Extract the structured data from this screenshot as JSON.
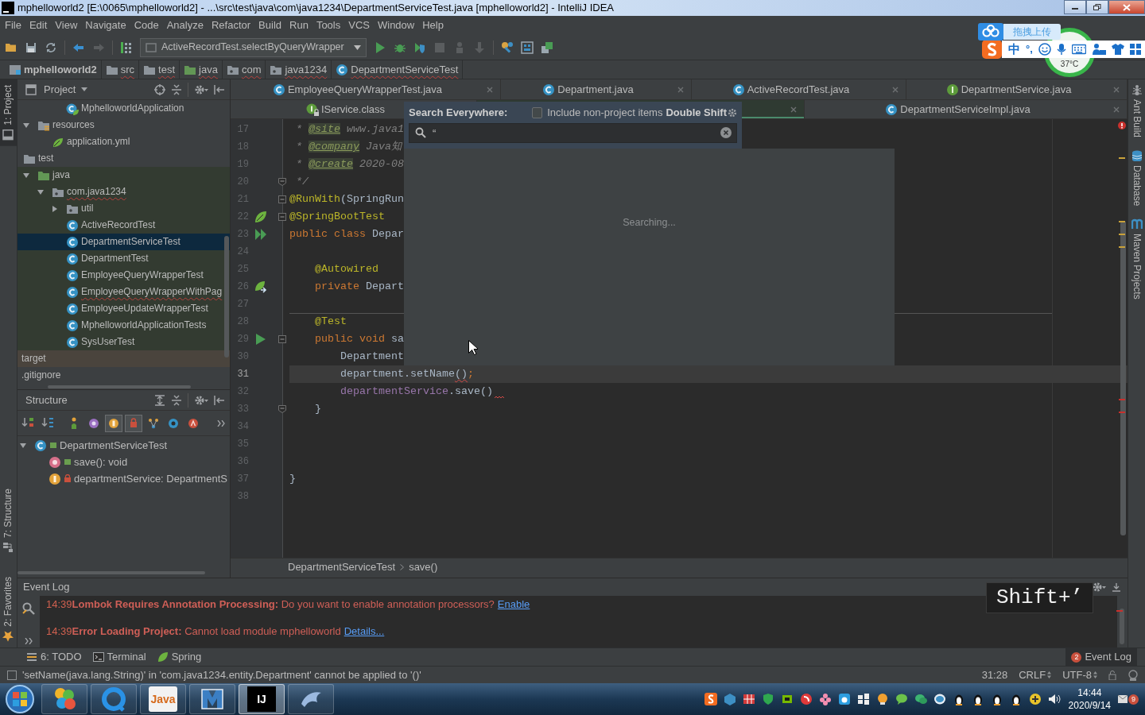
{
  "title_bar": {
    "title": "mphelloworld2 [E:\\0065\\mphelloworld2] - ...\\src\\test\\java\\com\\java1234\\DepartmentServiceTest.java [mphelloworld2] - IntelliJ IDEA"
  },
  "ime": {
    "upload_label": "拖拽上传",
    "mode": "中",
    "punctuation": "°,",
    "temperature": "37°C"
  },
  "menu": [
    "File",
    "Edit",
    "View",
    "Navigate",
    "Code",
    "Analyze",
    "Refactor",
    "Build",
    "Run",
    "Tools",
    "VCS",
    "Window",
    "Help"
  ],
  "toolbar": {
    "run_config": "ActiveRecordTest.selectByQueryWrapper"
  },
  "nav_bar": [
    {
      "label": "mphelloworld2",
      "kind": "module",
      "has_error": false
    },
    {
      "label": "src",
      "kind": "folder",
      "has_error": true
    },
    {
      "label": "test",
      "kind": "folder",
      "has_error": true
    },
    {
      "label": "java",
      "kind": "test-folder",
      "has_error": true
    },
    {
      "label": "com",
      "kind": "package",
      "has_error": true
    },
    {
      "label": "java1234",
      "kind": "package",
      "has_error": true
    },
    {
      "label": "DepartmentServiceTest",
      "kind": "class",
      "has_error": true
    }
  ],
  "left_strip": [
    {
      "label": "1: Project",
      "kind": "project",
      "selected": true
    },
    {
      "label": "7: Structure",
      "kind": "structure",
      "selected": false
    },
    {
      "label": "2: Favorites",
      "kind": "favorites",
      "selected": false
    }
  ],
  "right_strip": [
    {
      "label": "Ant Build",
      "kind": "ant",
      "selected": false
    },
    {
      "label": "Database",
      "kind": "database",
      "selected": false
    },
    {
      "label": "Maven Projects",
      "kind": "maven",
      "selected": false
    }
  ],
  "project_panel": {
    "title": "Project",
    "tree": [
      {
        "children": [
          {
            "children": [
              {
                "children": [
                  {
                    "children": [
                      {
                        "label": "MphelloworldApplication",
                        "kind": "spring-class",
                        "selected": false,
                        "has_error": false
                      }
                    ]
                  }
                ]
              },
              {
                "label": "resources",
                "kind": "resources-folder",
                "expanded": true,
                "selected": false,
                "has_error": false,
                "children": [
                  {
                    "label": "application.yml",
                    "kind": "yml",
                    "selected": false,
                    "has_error": false
                  }
                ]
              }
            ]
          },
          {
            "label": "test",
            "kind": "folder",
            "selected": false,
            "has_error": false,
            "children": [
              {
                "label": "java",
                "kind": "test-folder",
                "expanded": true,
                "selected": false,
                "has_error": false,
                "color": "#333b31",
                "children": [
                  {
                    "label": "com.java1234",
                    "kind": "package",
                    "expanded": true,
                    "selected": false,
                    "has_error": true,
                    "color": "#333b31",
                    "children": [
                      {
                        "label": "util",
                        "kind": "package",
                        "expanded": false,
                        "selected": false,
                        "has_error": false,
                        "color": "#333b31"
                      },
                      {
                        "label": "ActiveRecordTest",
                        "kind": "class",
                        "selected": false,
                        "has_error": false,
                        "color": "#333b31"
                      },
                      {
                        "label": "DepartmentServiceTest",
                        "kind": "class",
                        "selected": true,
                        "has_error": false
                      },
                      {
                        "label": "DepartmentTest",
                        "kind": "class",
                        "selected": false,
                        "has_error": false,
                        "color": "#333b31"
                      },
                      {
                        "label": "EmployeeQueryWrapperTest",
                        "kind": "class",
                        "selected": false,
                        "has_error": false,
                        "color": "#333b31"
                      },
                      {
                        "label": "EmployeeQueryWrapperWithPag",
                        "kind": "class",
                        "selected": false,
                        "has_error": true,
                        "color": "#333b31"
                      },
                      {
                        "label": "EmployeeUpdateWrapperTest",
                        "kind": "class",
                        "selected": false,
                        "has_error": false,
                        "color": "#333b31"
                      },
                      {
                        "label": "MphelloworldApplicationTests",
                        "kind": "class",
                        "selected": false,
                        "has_error": false,
                        "color": "#333b31"
                      },
                      {
                        "label": "SysUserTest",
                        "kind": "class",
                        "selected": false,
                        "has_error": false,
                        "color": "#333b31"
                      }
                    ]
                  }
                ]
              }
            ]
          }
        ]
      },
      {
        "label": "target",
        "selected": false,
        "has_error": false,
        "color": "#4a443d"
      },
      {
        "label": ".gitignore",
        "selected": false,
        "has_error": false
      }
    ]
  },
  "structure_panel": {
    "title": "Structure",
    "filters": [
      {
        "kind": "sort-visibility",
        "on": false
      },
      {
        "kind": "sort-alpha",
        "on": false
      },
      {
        "kind": "inherited",
        "on": false
      },
      {
        "kind": "properties",
        "on": false
      },
      {
        "kind": "fields",
        "on": true
      },
      {
        "kind": "non-public",
        "on": true
      },
      {
        "kind": "anonymous",
        "on": false
      },
      {
        "kind": "lambdas",
        "on": false
      },
      {
        "kind": "abstract",
        "on": false
      }
    ],
    "tree": [
      {
        "label": "DepartmentServiceTest",
        "kind": "class",
        "private": false,
        "expanded": true,
        "selected": false,
        "children": [
          {
            "label": "save(): void",
            "kind": "method",
            "private": false,
            "selected": false
          },
          {
            "label": "departmentService: DepartmentS",
            "kind": "field",
            "private": true,
            "selected": false
          }
        ]
      }
    ]
  },
  "editor": {
    "tab_rows": [
      [
        {
          "label": "EmployeeQueryWrapperTest.java",
          "kind": "class",
          "selected": false
        },
        {
          "label": "Department.java",
          "kind": "class",
          "selected": false
        },
        {
          "label": "ActiveRecordTest.java",
          "kind": "class",
          "selected": false
        },
        {
          "label": "DepartmentService.java",
          "kind": "interface",
          "selected": false
        }
      ],
      [
        {
          "label": "IService.class",
          "kind": "library-interface",
          "selected": false
        },
        {
          "selected": true
        },
        {
          "label": "DepartmentServiceImpl.java",
          "kind": "class",
          "selected": false
        }
      ]
    ],
    "lines": [
      {
        "number": "17",
        "segments": [
          {
            "text": " * ",
            "kind": "comment"
          },
          {
            "text": "@site",
            "kind": "doc-tag"
          },
          {
            "text": " www.java1",
            "kind": "comment"
          }
        ]
      },
      {
        "number": "18",
        "segments": [
          {
            "text": " * ",
            "kind": "comment"
          },
          {
            "text": "@company",
            "kind": "doc-tag"
          },
          {
            "text": " Java知",
            "kind": "comment"
          }
        ]
      },
      {
        "number": "19",
        "segments": [
          {
            "text": " * ",
            "kind": "comment"
          },
          {
            "text": "@create",
            "kind": "doc-tag"
          },
          {
            "text": " 2020-08",
            "kind": "comment"
          }
        ]
      },
      {
        "number": "20",
        "fold": {
          "kind": "end"
        },
        "segments": [
          {
            "text": " */",
            "kind": "comment"
          }
        ]
      },
      {
        "number": "21",
        "fold": {
          "kind": "start"
        },
        "segments": [
          {
            "text": "@RunWith",
            "kind": "annotation"
          },
          {
            "text": "(SpringRun",
            "kind": "plain"
          }
        ]
      },
      {
        "number": "22",
        "gutter": {
          "kind": "spring"
        },
        "fold": {
          "kind": "start"
        },
        "segments": [
          {
            "text": "@SpringBootTest",
            "kind": "annotation"
          }
        ]
      },
      {
        "number": "23",
        "gutter": {
          "kind": "run-class"
        },
        "segments": [
          {
            "text": "public class ",
            "kind": "keyword"
          },
          {
            "text": "Depar",
            "kind": "plain"
          }
        ]
      },
      {
        "number": "24"
      },
      {
        "number": "25",
        "segments": [
          {
            "text": "    @Autowired",
            "kind": "annotation"
          }
        ]
      },
      {
        "number": "26",
        "gutter": {
          "kind": "autowired"
        },
        "segments": [
          {
            "text": "    private ",
            "kind": "keyword"
          },
          {
            "text": "Depart",
            "kind": "plain"
          }
        ]
      },
      {
        "number": "27"
      },
      {
        "number": "28",
        "separator_above": true,
        "segments": [
          {
            "text": "    @Test",
            "kind": "annotation"
          }
        ]
      },
      {
        "number": "29",
        "gutter": {
          "kind": "run-method"
        },
        "fold": {
          "kind": "start"
        },
        "segments": [
          {
            "text": "    public void ",
            "kind": "keyword"
          },
          {
            "text": "sa",
            "kind": "plain"
          }
        ]
      },
      {
        "number": "30",
        "segments": [
          {
            "text": "        Department",
            "kind": "plain"
          }
        ]
      },
      {
        "number": "31",
        "current": true,
        "segments": [
          {
            "text": "        department.setName",
            "kind": "plain"
          },
          {
            "text": "()",
            "kind": "error"
          },
          {
            "text": ";",
            "kind": "keyword"
          }
        ]
      },
      {
        "number": "32",
        "error_after": true,
        "segments": [
          {
            "text": "        departmentService",
            "kind": "field"
          },
          {
            "text": ".save()",
            "kind": "plain"
          }
        ]
      },
      {
        "number": "33",
        "fold": {
          "kind": "end"
        },
        "segments": [
          {
            "text": "    }",
            "kind": "plain"
          }
        ]
      },
      {
        "number": "34"
      },
      {
        "number": "35"
      },
      {
        "number": "36"
      },
      {
        "number": "37",
        "segments": [
          {
            "text": "}",
            "kind": "plain"
          }
        ]
      },
      {
        "number": "38"
      }
    ],
    "breadcrumb": [
      "DepartmentServiceTest",
      "save()"
    ]
  },
  "search_popup": {
    "title": "Search Everywhere:",
    "option": {
      "label": "Include non-project items",
      "checked": false
    },
    "shortcut": "Double Shift",
    "query": "“",
    "status": "Searching..."
  },
  "event_log": {
    "title": "Event Log",
    "entries": [
      {
        "time": "14:39",
        "message": "**Lombok Requires Annotation Processing:** Do you want to enable annotation processors?",
        "link": "Enable"
      },
      {
        "time": "14:39",
        "message": "**Error Loading Project:** Cannot load module mphelloworld",
        "link": "Details..."
      }
    ],
    "keystroke_overlay": "Shift+’"
  },
  "bottom_bar": {
    "left": [
      {
        "label": "6: TODO",
        "kind": "todo",
        "selected": false
      },
      {
        "label": "Terminal",
        "kind": "terminal",
        "selected": false
      },
      {
        "label": "Spring",
        "kind": "spring",
        "selected": false
      }
    ],
    "right": [
      {
        "label": "Event Log",
        "badge": "2",
        "selected": true
      }
    ]
  },
  "status_bar": {
    "message": "'setName(java.lang.String)' in 'com.java1234.entity.Department' cannot be applied to '()'",
    "position": "31:28",
    "line_separator": "CRLF",
    "encoding": "UTF-8"
  },
  "taskbar": {
    "apps": [
      {
        "kind": "pinwheel",
        "selected": false
      },
      {
        "kind": "ring",
        "selected": false
      },
      {
        "kind": "java",
        "label": "Java",
        "selected": false
      },
      {
        "kind": "fold",
        "selected": false
      },
      {
        "kind": "ide",
        "label": "IJ",
        "selected": true
      },
      {
        "kind": "dolphin",
        "selected": false
      }
    ],
    "time": "14:44",
    "date": "2020/9/14",
    "notification_count": "9"
  }
}
